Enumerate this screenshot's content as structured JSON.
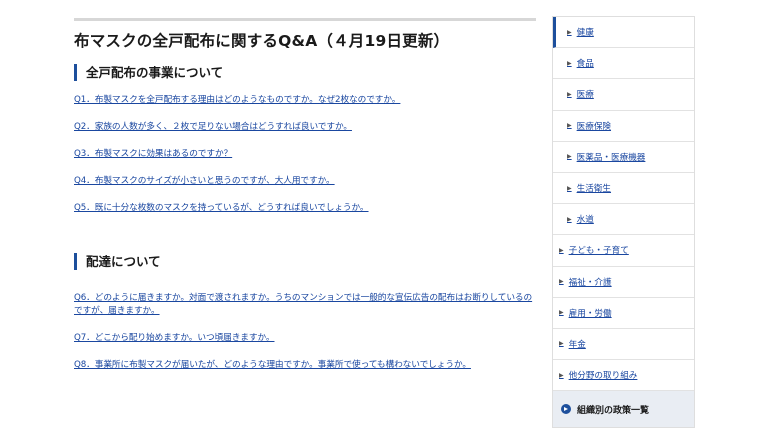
{
  "main": {
    "title": "布マスクの全戸配布に関するQ&A（４月19日更新）",
    "section1": {
      "heading": "全戸配布の事業について",
      "questions": [
        "Q1．布製マスクを全戸配布する理由はどのようなものですか。なぜ2枚なのですか。",
        "Q2．家族の人数が多く、２枚で足りない場合はどうすれば良いですか。",
        "Q3．布製マスクに効果はあるのですか？",
        "Q4．布製マスクのサイズが小さいと思うのですが、大人用ですか。",
        "Q5．既に十分な枚数のマスクを持っているが、どうすれば良いでしょうか。"
      ]
    },
    "section2": {
      "heading": "配達について",
      "questions": [
        "Q6．どのように届きますか。対面で渡されますか。うちのマンションでは一般的な宣伝広告の配布はお断りしているのですが、届きますか。",
        "Q7．どこから配り始めますか。いつ頃届きますか。",
        "Q8．事業所に布製マスクが届いたが、どのような理由ですか。事業所で使っても構わないでしょうか。"
      ]
    }
  },
  "sidebar": {
    "sub_items": [
      "健康",
      "食品",
      "医療",
      "医療保険",
      "医薬品・医療機器",
      "生活衛生",
      "水道"
    ],
    "top_items": [
      "子ども・子育て",
      "福祉・介護",
      "雇用・労働",
      "年金",
      "他分野の取り組み"
    ],
    "footer_label": "組織別の政策一覧",
    "accent_color": "#1d4f9c",
    "link_color": "#1a47a0"
  }
}
